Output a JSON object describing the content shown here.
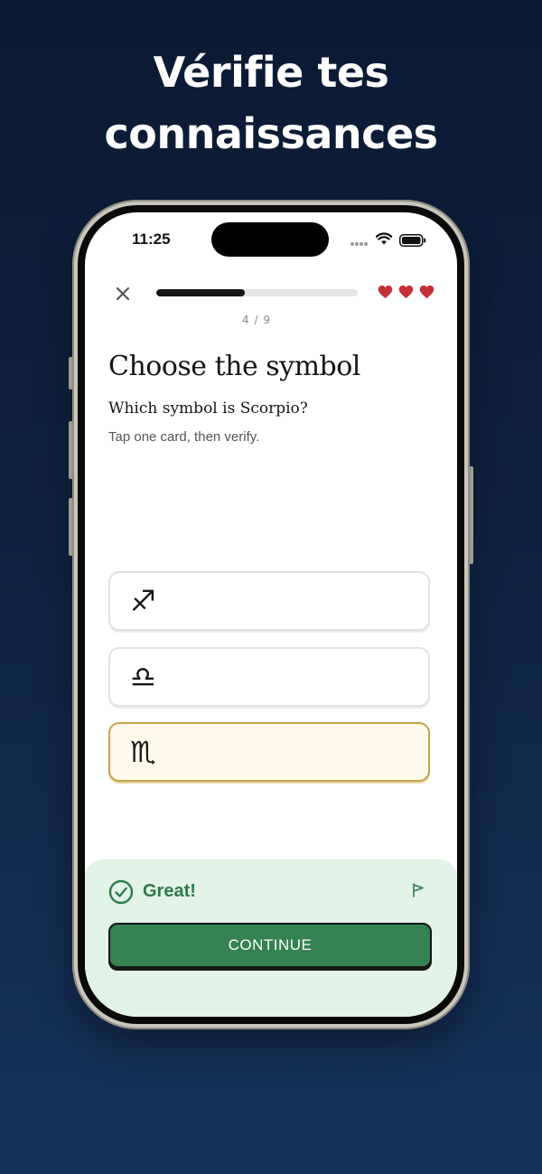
{
  "headline": {
    "line1": "Vérifie tes",
    "line2": "connaissances"
  },
  "status_bar": {
    "time": "11:25"
  },
  "quiz": {
    "progress": {
      "current": 4,
      "total": 9,
      "label": "4 / 9",
      "fraction": 0.44
    },
    "lives": 3,
    "title": "Choose the symbol",
    "question": "Which symbol is Scorpio?",
    "hint": "Tap one card, then verify.",
    "options": [
      {
        "symbol": "♐",
        "icon": "sagittarius-icon",
        "selected": false
      },
      {
        "symbol": "♎",
        "icon": "libra-icon",
        "selected": false
      },
      {
        "symbol": "♏",
        "icon": "scorpio-icon",
        "selected": true
      }
    ]
  },
  "feedback": {
    "message": "Great!",
    "continue_label": "CONTINUE"
  },
  "colors": {
    "background_top": "#0b1a33",
    "background_bottom": "#15325a",
    "heart": "#c62f36",
    "success": "#2f7a4a",
    "button": "#33824f",
    "selected_border": "#c5a24a",
    "selected_fill": "#fffaeb",
    "feedback_panel": "#e2f3e7"
  }
}
